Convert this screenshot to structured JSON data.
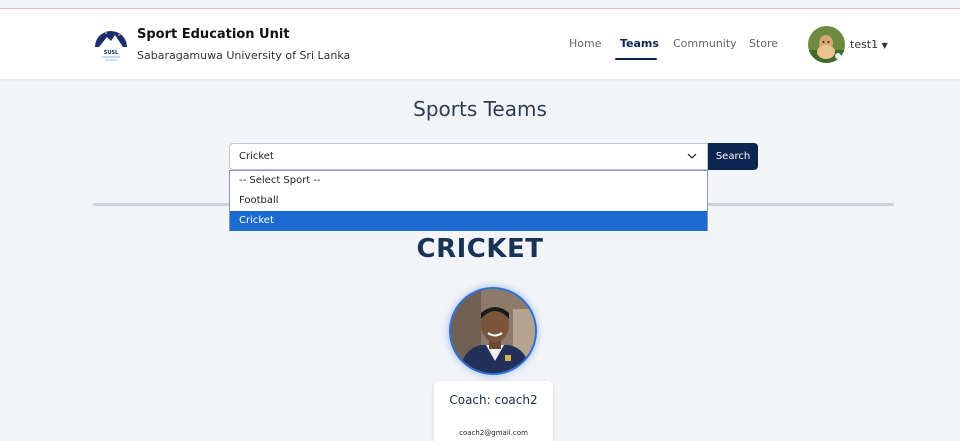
{
  "header": {
    "brand_title": "Sport Education Unit",
    "brand_subtitle": "Sabaragamuwa University of Sri Lanka",
    "logo_text": "SUSL",
    "logo_icon": "university-logo-icon",
    "nav": [
      {
        "label": "Home",
        "active": false
      },
      {
        "label": "Teams",
        "active": true
      },
      {
        "label": "Community",
        "active": false
      },
      {
        "label": "Store",
        "active": false
      }
    ],
    "user": {
      "name": "test1",
      "avatar_icon": "user-avatar-icon",
      "caret_icon": "caret-down-icon"
    }
  },
  "page": {
    "title": "Sports Teams"
  },
  "search": {
    "selected_value": "Cricket",
    "button_label": "Search",
    "chevron_icon": "chevron-down-icon",
    "options": [
      "-- Select Sport --",
      "Football",
      "Cricket"
    ],
    "highlighted_option": "Cricket"
  },
  "team": {
    "sport_heading": "CRICKET",
    "coach_label": "Coach: coach2",
    "coach_email": "coach2@gmail.com",
    "coach_photo_icon": "coach-photo"
  },
  "colors": {
    "accent": "#0d2550",
    "highlight": "#1b6ad0",
    "page_bg": "#f2f4f7",
    "photo_ring": "#2e6fd9"
  }
}
